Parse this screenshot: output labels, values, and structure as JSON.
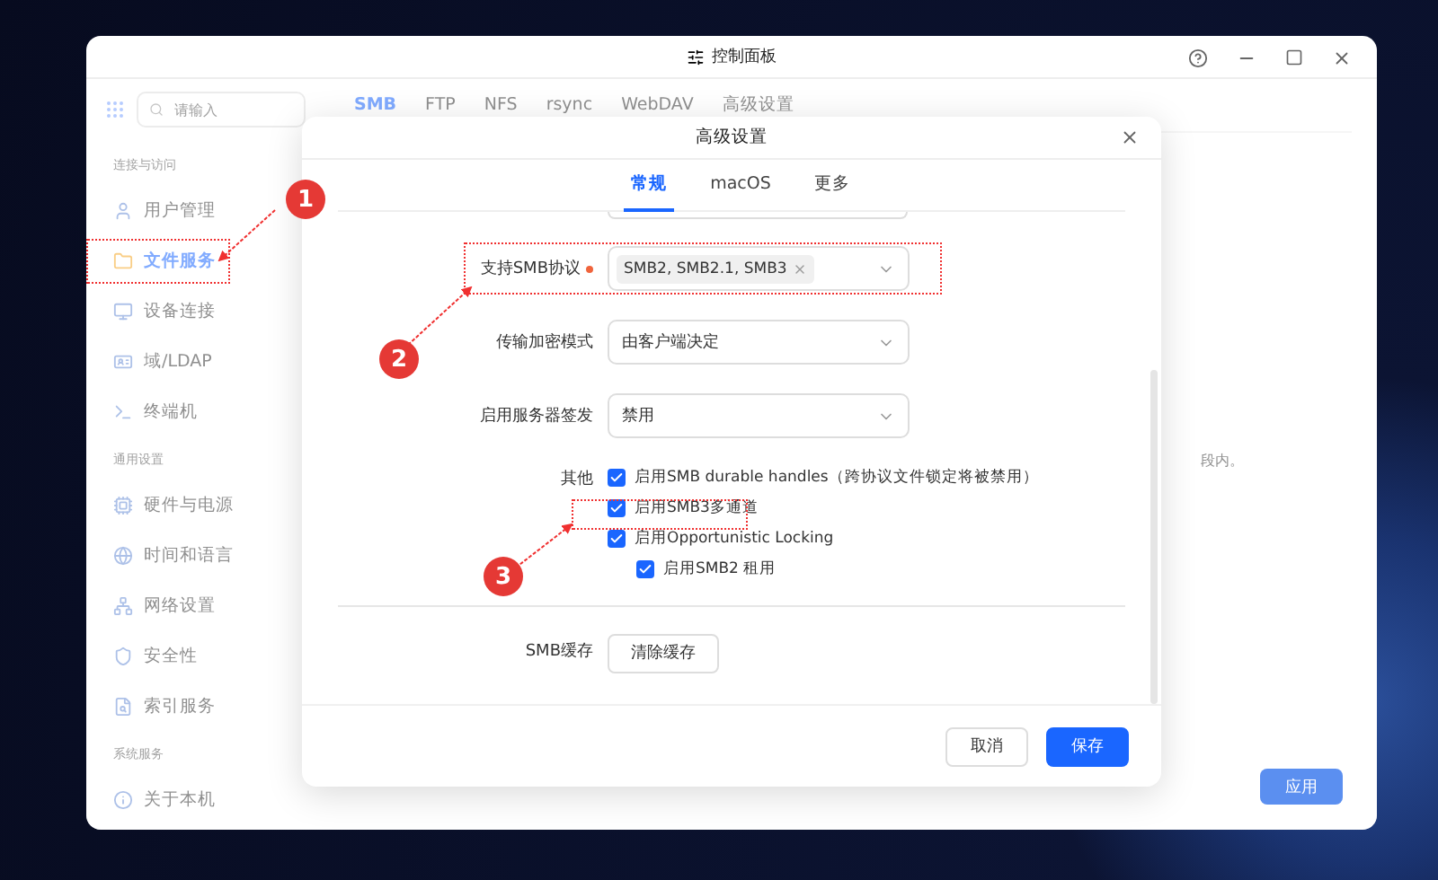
{
  "window": {
    "title": "控制面板"
  },
  "sidebar": {
    "search": {
      "placeholder": "请输入"
    },
    "groups": [
      {
        "title": "连接与访问",
        "items": [
          {
            "label": "用户管理",
            "selected": false
          },
          {
            "label": "文件服务",
            "selected": true
          },
          {
            "label": "设备连接",
            "selected": false
          },
          {
            "label": "域/LDAP",
            "selected": false
          },
          {
            "label": "终端机",
            "selected": false
          }
        ]
      },
      {
        "title": "通用设置",
        "items": [
          {
            "label": "硬件与电源",
            "selected": false
          },
          {
            "label": "时间和语言",
            "selected": false
          },
          {
            "label": "网络设置",
            "selected": false
          },
          {
            "label": "安全性",
            "selected": false
          },
          {
            "label": "索引服务",
            "selected": false
          }
        ]
      },
      {
        "title": "系统服务",
        "items": [
          {
            "label": "关于本机",
            "selected": false
          }
        ]
      }
    ]
  },
  "tabs": [
    {
      "label": "SMB",
      "selected": true
    },
    {
      "label": "FTP",
      "selected": false
    },
    {
      "label": "NFS",
      "selected": false
    },
    {
      "label": "rsync",
      "selected": false
    },
    {
      "label": "WebDAV",
      "selected": false
    },
    {
      "label": "高级设置",
      "selected": false
    }
  ],
  "background_note": "段内。",
  "apply_button": {
    "label": "应用",
    "disabled": true
  },
  "dialog": {
    "title": "高级设置",
    "tabs": [
      {
        "label": "常规",
        "selected": true
      },
      {
        "label": "macOS",
        "selected": false
      },
      {
        "label": "更多",
        "selected": false
      }
    ],
    "fields": [
      {
        "label": "支持SMB协议",
        "required": true,
        "kind": "tags",
        "tags": [
          "SMB2, SMB2.1, SMB3"
        ]
      },
      {
        "label": "传输加密模式",
        "required": false,
        "kind": "select",
        "value": "由客户端决定"
      },
      {
        "label": "启用服务器签发",
        "required": false,
        "kind": "select",
        "value": "禁用"
      }
    ],
    "other": {
      "label": "其他",
      "options": [
        {
          "label": "启用SMB durable handles（跨协议文件锁定将被禁用）",
          "checked": true
        },
        {
          "label": "启用SMB3多通道",
          "checked": true
        },
        {
          "label": "启用Opportunistic Locking",
          "checked": true,
          "children": [
            {
              "label": "启用SMB2 租用",
              "checked": true
            }
          ]
        }
      ]
    },
    "cache": {
      "label": "SMB缓存",
      "button": "清除缓存"
    },
    "buttons": [
      {
        "label": "取消",
        "kind": "secondary"
      },
      {
        "label": "保存",
        "kind": "primary"
      }
    ]
  },
  "annotations": [
    {
      "number": "1"
    },
    {
      "number": "2"
    },
    {
      "number": "3"
    }
  ]
}
